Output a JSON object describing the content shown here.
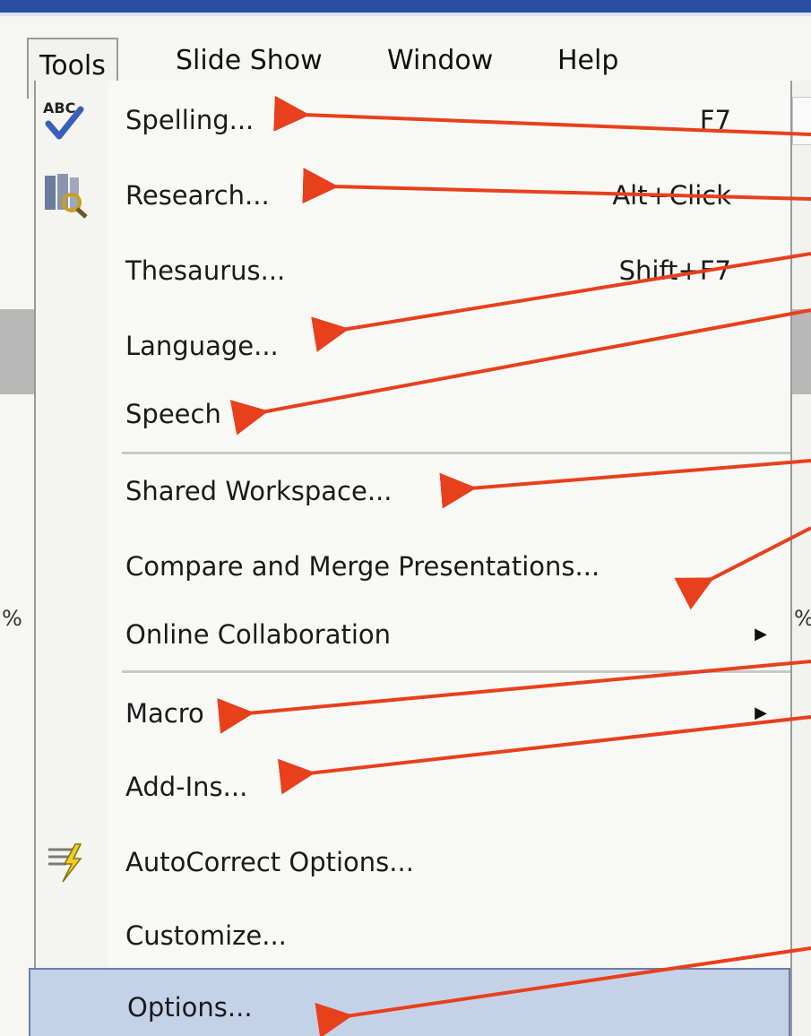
{
  "menubar": {
    "items": [
      {
        "label": "Tools",
        "active": true
      },
      {
        "label": "Slide Show",
        "active": false
      },
      {
        "label": "Window",
        "active": false
      },
      {
        "label": "Help",
        "active": false
      }
    ]
  },
  "menu": {
    "items": [
      {
        "label": "Spelling...",
        "shortcut": "F7",
        "icon": "spelling-check-icon"
      },
      {
        "label": "Research...",
        "shortcut": "Alt+Click",
        "icon": "research-icon"
      },
      {
        "label": "Thesaurus...",
        "shortcut": "Shift+F7"
      },
      {
        "label": "Language..."
      },
      {
        "label": "Speech"
      },
      {
        "label": "Shared Workspace..."
      },
      {
        "label": "Compare and Merge Presentations..."
      },
      {
        "label": "Online Collaboration",
        "submenu": true
      },
      {
        "label": "Macro",
        "submenu": true
      },
      {
        "label": "Add-Ins..."
      },
      {
        "label": "AutoCorrect Options...",
        "icon": "autocorrect-lightning-icon"
      },
      {
        "label": "Customize..."
      },
      {
        "label": "Options...",
        "highlighted": true
      }
    ]
  },
  "background": {
    "edge_glyph_left": "%",
    "edge_glyph_right": "%"
  },
  "colors": {
    "title_bar": "#2a4fa0",
    "highlight_fill": "#c4d2e8",
    "highlight_border": "#6b7ea6",
    "annotation_arrow": "#e8401c"
  }
}
